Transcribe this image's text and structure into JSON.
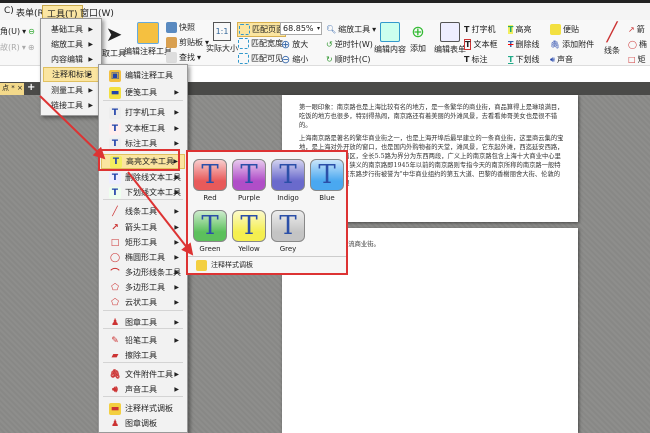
{
  "menubar": {
    "items": [
      "C)",
      "表单(R)",
      "工具(T)",
      "窗口(W)"
    ]
  },
  "toolbar": {
    "left": [
      "角(U)",
      "故(R)"
    ],
    "select_tool": "取工具",
    "edit_annot": "编辑注释工具",
    "snapshot": "快照",
    "clipboard": "剪贴板",
    "find": "查找",
    "actual_size": "实际大小",
    "actual_size_icon": "1:1",
    "fit_page": "匹配页面",
    "fit_width": "匹配宽度",
    "fit_visible": "匹配可见",
    "zoom_value": "68.85%",
    "zoom_in": "放大",
    "zoom_out": "缩小",
    "zoom_tool": "缩放工具",
    "rotate_ccw": "逆时针(W)",
    "rotate_cw": "顺时针(C)",
    "edit_content": "编辑内容",
    "add": "添加",
    "edit_form": "编辑表单",
    "typewriter": "打字机",
    "textbox": "文本框",
    "callout": "标注",
    "highlight": "高亮",
    "strikeout": "删除线",
    "underline": "下划线",
    "note": "便贴",
    "attach": "添加附件",
    "sound": "声音",
    "line": "线条",
    "arrow": "箭",
    "ellipse": "椭",
    "rect": "矩"
  },
  "tab": {
    "label": "点 *",
    "close": "×",
    "new": "+"
  },
  "tools_menu": {
    "items": [
      "基础工具",
      "缩放工具",
      "内容编辑",
      "注释和标记",
      "测量工具",
      "链接工具"
    ]
  },
  "annot_menu": {
    "items": [
      "编辑注释工具",
      "便笺工具",
      "打字机工具",
      "文本框工具",
      "标注工具",
      "高亮文本工具",
      "删除线文本工具",
      "下划线文本工具",
      "线条工具",
      "箭头工具",
      "矩形工具",
      "椭圆形工具",
      "多边形线条工具",
      "多边形工具",
      "云状工具",
      "图章工具",
      "铅笔工具",
      "擦除工具",
      "文件附件工具",
      "声音工具",
      "注释样式调板",
      "图章调板"
    ]
  },
  "palette": {
    "colors": [
      {
        "name": "Red",
        "color": "#e85a5a"
      },
      {
        "name": "Purple",
        "color": "#b04ec8"
      },
      {
        "name": "Indigo",
        "color": "#6a6acc"
      },
      {
        "name": "Blue",
        "color": "#4aa8f0"
      },
      {
        "name": "Green",
        "color": "#5cc05c"
      },
      {
        "name": "Yellow",
        "color": "#f5ef50"
      },
      {
        "name": "Grey",
        "color": "#c4c4c4"
      }
    ],
    "footer": "注释样式调板"
  },
  "document": {
    "p1": "第一眼印象：南京路也是上海比较有名的地方，是一条繁华的商业街，商品算得上是琳琅满目，吃饭的地方也很多，特别得热闹，南京路还有着美丽的外滩风景，去看看帅哥美女也是很不错的。",
    "p2": "上海南京路是著名的繁华商业街之一，也是上海开埠后最早建立的一条商业街，这里商云集的宝地，是上海对外开放的窗口，也是国内外购物者的天堂，滩风景，它东起外滩，西迄延安西路，横跨静安、黄浦两区，全长5.5路为界分为东西两段，广义上的南京路包含上海十大商业中心里的西与南京西路，狭义的南京路即1945年以前的南京路则专指今天的南京所称的南京路一般特指南京东路，南京东路步行街被誉为\"中华商业组约的第五大道、巴黎的香榭丽舍大街、伦敦的牛津街、东京的银",
    "p3": "一流商业街。"
  },
  "accent": "#d33333"
}
